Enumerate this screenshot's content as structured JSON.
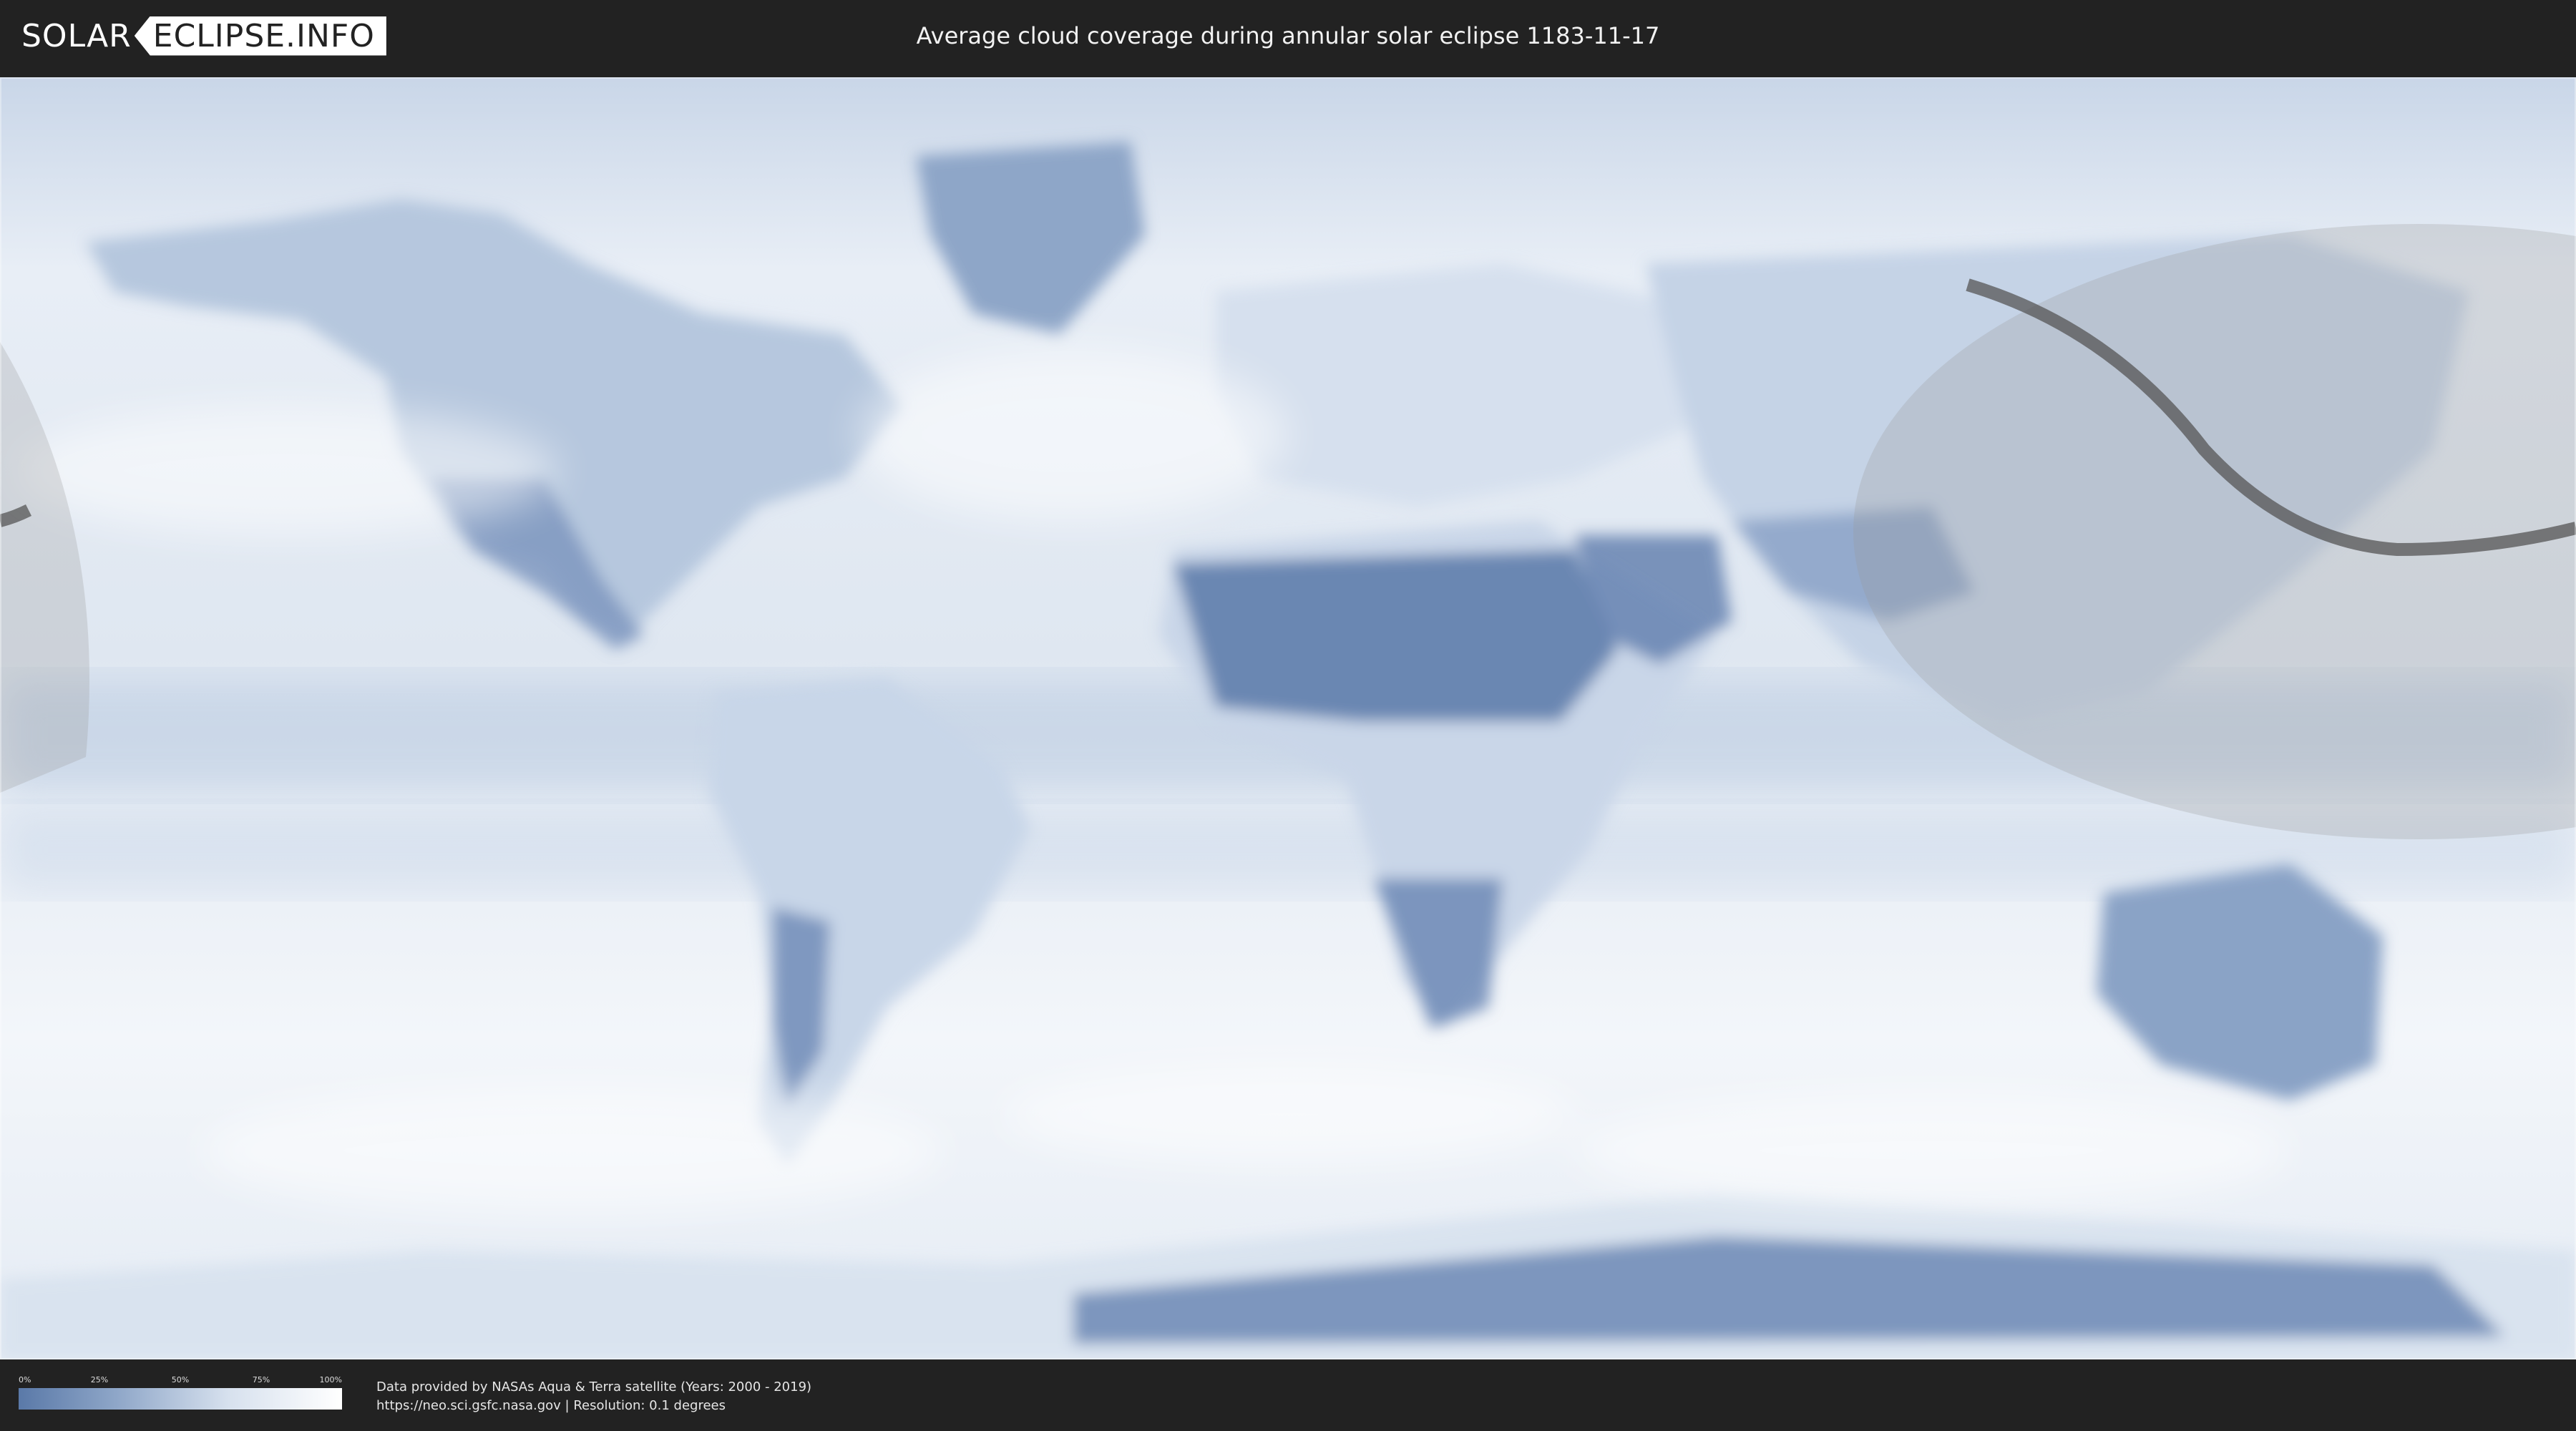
{
  "header": {
    "logo_solar": "SOLAR",
    "logo_eclipse": "ECLIPSE.INFO",
    "title": "Average cloud coverage during annular solar eclipse 1183-11-17"
  },
  "map": {
    "description_colors": {
      "clear": "#5a79a8",
      "cloudy": "#ffffff",
      "eclipse_shadow": "#9a9a9a",
      "path_line": "#555555"
    }
  },
  "legend": {
    "ticks": [
      "0%",
      "25%",
      "50%",
      "75%",
      "100%"
    ]
  },
  "credits": {
    "line1": "Data provided by NASAs Aqua & Terra satellite (Years: 2000 - 2019)",
    "line2": "https://neo.sci.gsfc.nasa.gov | Resolution: 0.1 degrees"
  }
}
